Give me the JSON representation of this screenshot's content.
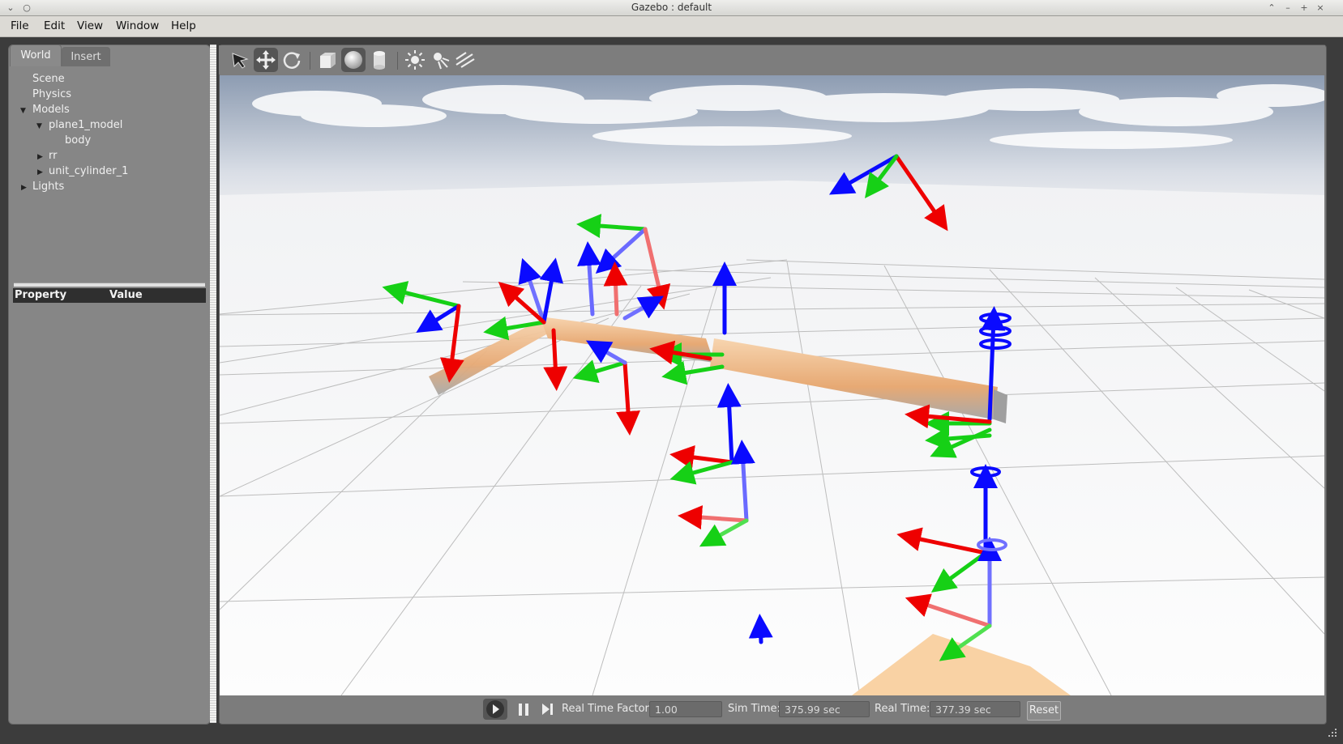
{
  "window": {
    "title": "Gazebo : default"
  },
  "menu": {
    "items": [
      "File",
      "Edit",
      "View",
      "Window",
      "Help"
    ]
  },
  "left_panel": {
    "tabs": [
      "World",
      "Insert"
    ],
    "tree": [
      "Scene",
      "Physics",
      "Models",
      "plane1_model",
      "body",
      "rr",
      "unit_cylinder_1",
      "Lights"
    ],
    "property_header": {
      "property": "Property",
      "value": "Value"
    }
  },
  "toolbar": {
    "tools": [
      "select-arrow-icon",
      "translate-icon",
      "rotate-icon",
      "box-icon",
      "sphere-icon",
      "cylinder-icon",
      "point-light-icon",
      "spot-light-icon",
      "directional-light-icon"
    ]
  },
  "status": {
    "real_time_factor_label": "Real Time Factor:",
    "real_time_factor": "1.00",
    "sim_time_label": "Sim Time:",
    "sim_time": "375.99 sec",
    "real_time_label": "Real Time:",
    "real_time": "377.39 sec",
    "reset_label": "Reset"
  },
  "colors": {
    "x_axis": "#ff0000",
    "y_axis": "#00dd00",
    "z_axis": "#0000ff",
    "model": "#f4c08e"
  }
}
